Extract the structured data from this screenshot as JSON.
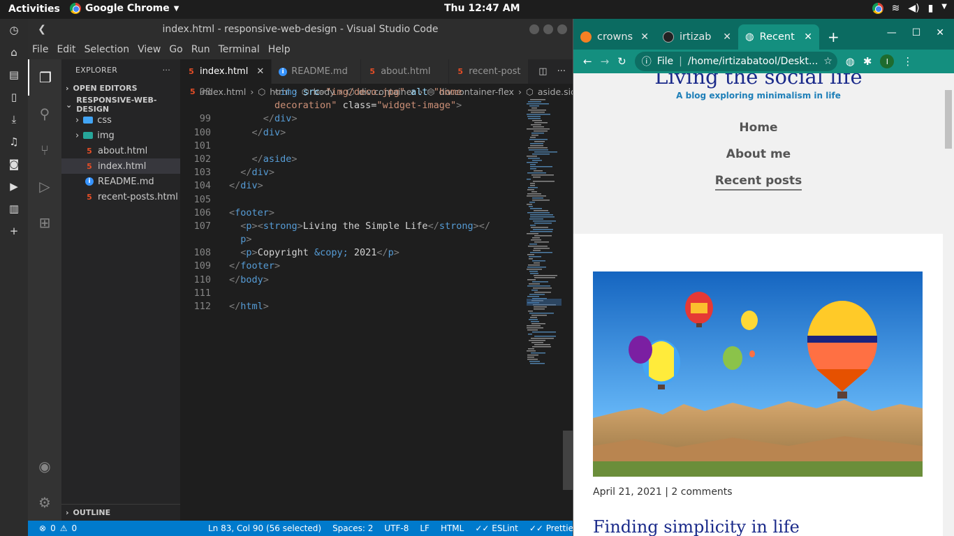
{
  "topbar": {
    "activities": "Activities",
    "app_name": "Google Chrome",
    "clock": "Thu 12:47 AM"
  },
  "vscode": {
    "title": "index.html - responsive-web-design - Visual Studio Code",
    "menu": [
      "File",
      "Edit",
      "Selection",
      "View",
      "Go",
      "Run",
      "Terminal",
      "Help"
    ],
    "explorer": {
      "header": "EXPLORER",
      "open_editors": "OPEN EDITORS",
      "project": "RESPONSIVE-WEB-DESIGN",
      "items": [
        {
          "name": "css",
          "kind": "folder"
        },
        {
          "name": "img",
          "kind": "folder"
        },
        {
          "name": "about.html",
          "kind": "html"
        },
        {
          "name": "index.html",
          "kind": "html",
          "selected": true
        },
        {
          "name": "README.md",
          "kind": "info"
        },
        {
          "name": "recent-posts.html",
          "kind": "html"
        }
      ],
      "outline": "OUTLINE"
    },
    "tabs": [
      {
        "label": "index.html",
        "icon": "html",
        "active": true
      },
      {
        "label": "README.md",
        "icon": "info"
      },
      {
        "label": "about.html",
        "icon": "html"
      },
      {
        "label": "recent-post",
        "icon": "html"
      }
    ],
    "breadcrumbs": [
      "index.html",
      "html",
      "body",
      "div.container",
      "div.container-flex",
      "aside.sid"
    ],
    "code_lines": [
      {
        "n": "98",
        "text": "        <img src=\"img/deco.jpg\" alt=\"home"
      },
      {
        "n": "",
        "text": "        decoration\" class=\"widget-image\">"
      },
      {
        "n": "99",
        "text": "      </div>"
      },
      {
        "n": "100",
        "text": "    </div>"
      },
      {
        "n": "101",
        "text": ""
      },
      {
        "n": "102",
        "text": "    </aside>"
      },
      {
        "n": "103",
        "text": "  </div>"
      },
      {
        "n": "104",
        "text": "</div>"
      },
      {
        "n": "105",
        "text": ""
      },
      {
        "n": "106",
        "text": "<footer>"
      },
      {
        "n": "107",
        "text": "  <p><strong>Living the Simple Life</strong></"
      },
      {
        "n": "",
        "text": "  p>"
      },
      {
        "n": "108",
        "text": "  <p>Copyright &copy; 2021</p>"
      },
      {
        "n": "109",
        "text": "</footer>"
      },
      {
        "n": "110",
        "text": "</body>"
      },
      {
        "n": "111",
        "text": ""
      },
      {
        "n": "112",
        "text": "</html>"
      }
    ],
    "status": {
      "errors": "0",
      "warnings": "0",
      "position": "Ln 83, Col 90 (56 selected)",
      "spaces": "Spaces: 2",
      "encoding": "UTF-8",
      "eol": "LF",
      "language": "HTML",
      "eslint": "ESLint",
      "prettier": "Prettier"
    }
  },
  "chrome": {
    "tabs": [
      {
        "label": "crowns"
      },
      {
        "label": "irtizab"
      },
      {
        "label": "Recent",
        "active": true
      }
    ],
    "address_scheme": "File",
    "address": "/home/irtizabatool/Deskt...",
    "profile_initial": "I",
    "page": {
      "title": "Living the social life",
      "tagline": "A blog exploring minimalism in life",
      "nav": [
        "Home",
        "About me",
        "Recent posts"
      ],
      "meta_date": "April 21, 2021",
      "meta_comments": "2 comments",
      "post_title": "Finding simplicity in life"
    }
  },
  "colors": {
    "vscode_status": "#007acc",
    "chrome_theme": "#148f7f",
    "site_title": "#1a2a8a",
    "tagline": "#1e7fb8"
  }
}
